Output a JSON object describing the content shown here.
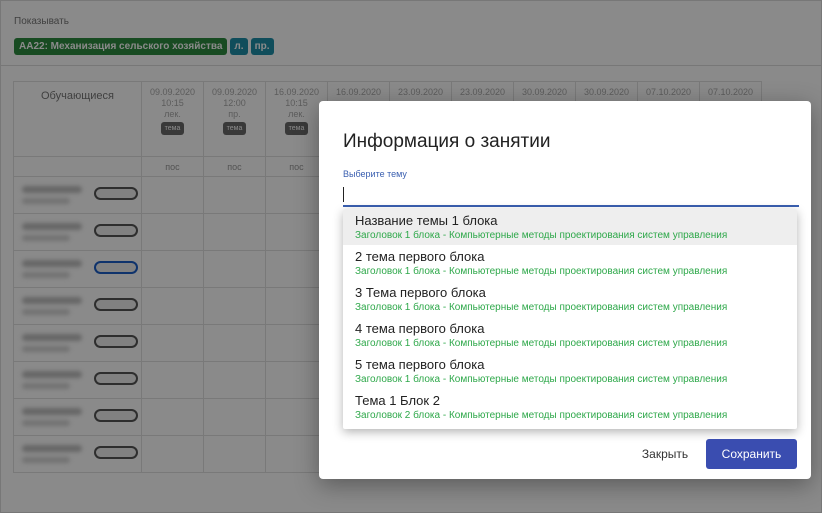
{
  "background": {
    "show_label": "Показывать",
    "chips": [
      "АА22: Механизация сельского хозяйства",
      "л.",
      "пр."
    ],
    "students_header": "Обучающиеся",
    "columns": [
      {
        "date": "09.09.2020",
        "time": "10:15",
        "type": "лек.",
        "tag": "тема",
        "pos": "пос"
      },
      {
        "date": "09.09.2020",
        "time": "12:00",
        "type": "пр.",
        "tag": "тема",
        "pos": "пос"
      },
      {
        "date": "16.09.2020",
        "time": "10:15",
        "type": "лек.",
        "tag": "тема",
        "pos": "пос"
      },
      {
        "date": "16.09.2020"
      },
      {
        "date": "23.09.2020"
      },
      {
        "date": "23.09.2020"
      },
      {
        "date": "30.09.2020"
      },
      {
        "date": "30.09.2020"
      },
      {
        "date": "07.10.2020"
      },
      {
        "date": "07.10.2020"
      }
    ]
  },
  "modal": {
    "title": "Информация о занятии",
    "field_label": "Выберите тему",
    "field_value": "",
    "options": [
      {
        "title": "Название темы 1 блока",
        "subtitle": "Заголовок 1 блока - Компьютерные методы проектирования систем управления"
      },
      {
        "title": "2 тема первого блока",
        "subtitle": "Заголовок 1 блока - Компьютерные методы проектирования систем управления"
      },
      {
        "title": "3 Тема первого блока",
        "subtitle": "Заголовок 1 блока - Компьютерные методы проектирования систем управления"
      },
      {
        "title": "4 тема первого блока",
        "subtitle": "Заголовок 1 блока - Компьютерные методы проектирования систем управления"
      },
      {
        "title": "5 тема первого блока",
        "subtitle": "Заголовок 1 блока - Компьютерные методы проектирования систем управления"
      },
      {
        "title": "Тема 1 Блок 2",
        "subtitle": "Заголовок 2 блока - Компьютерные методы проектирования систем управления"
      }
    ],
    "close_label": "Закрыть",
    "save_label": "Сохранить"
  },
  "colors": {
    "accent": "#3a4db0",
    "option_subtitle": "#2ea84a",
    "chip_green": "#2e8b3f",
    "chip_teal": "#1f8fa8"
  }
}
